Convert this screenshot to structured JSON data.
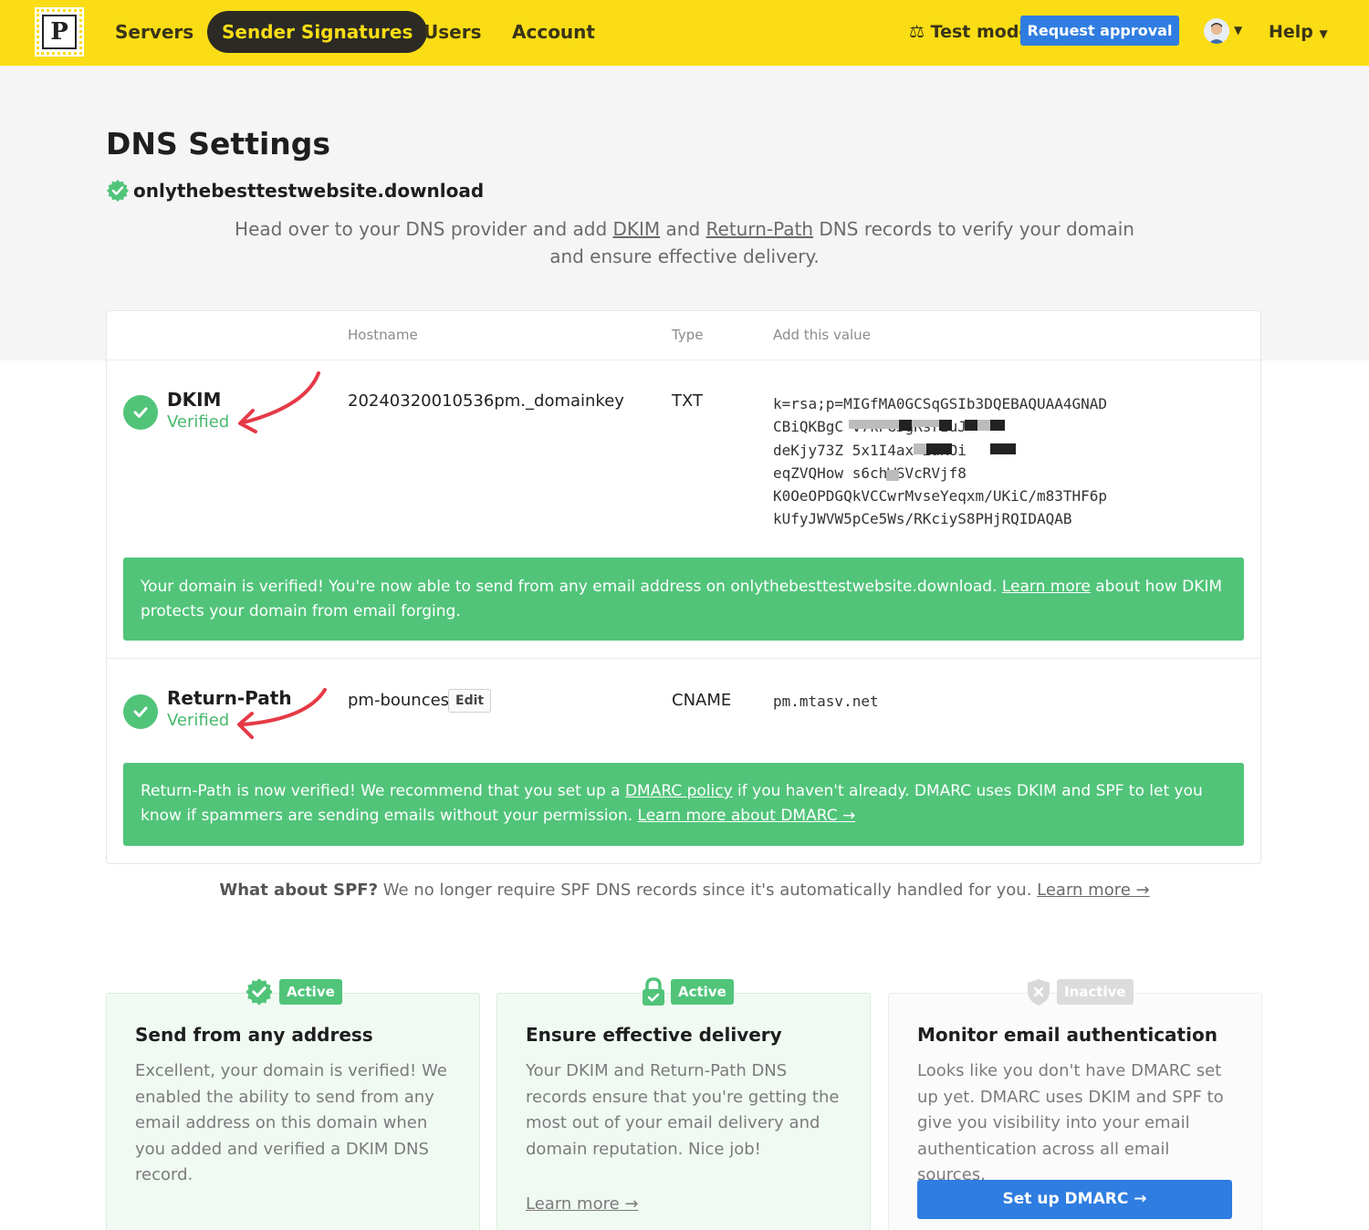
{
  "nav": {
    "logo_letter": "P",
    "items": [
      {
        "label": "Servers"
      },
      {
        "label": "Sender Signatures",
        "active": true
      },
      {
        "label": "Users"
      },
      {
        "label": "Account"
      }
    ],
    "test_mode": "Test mode",
    "request_approval": "Request approval",
    "help": "Help"
  },
  "header": {
    "title": "DNS Settings",
    "domain": "onlythebesttestwebsite.download",
    "intro": {
      "p1": "Head over to your DNS provider and add ",
      "dkim_link": "DKIM",
      "p2": " and ",
      "rp_link": "Return-Path",
      "p3": " DNS records to verify your domain and ensure effective delivery."
    }
  },
  "table": {
    "columns": {
      "hostname": "Hostname",
      "type": "Type",
      "value": "Add this value"
    },
    "dkim": {
      "name": "DKIM",
      "status": "Verified",
      "hostname": "20240320010536pm._domainkey",
      "type": "TXT",
      "value_lines": [
        "k=rsa;p=MIGfMA0GCSqGSIb3DQEBAQUAA4GNAD",
        "CBiQKBgC                   v7kPG3gRsrzuJ",
        "deKjy73Z                   5x1I4ax+2aKOi",
        "eqZVQHow                   s6chWSVcRVjf8",
        "K0OeOPDGQkVCCwrMvseYeqxm/UKiC/m83THF6p",
        "kUfyJWVW5pCe5Ws/RKciyS8PHjRQIDAQAB"
      ],
      "notice": {
        "p1": "Your domain is verified! You're now able to send from any email address on onlythebesttestwebsite.download. ",
        "link": "Learn more",
        "p2": " about how DKIM protects your domain from email forging."
      }
    },
    "return_path": {
      "name": "Return-Path",
      "status": "Verified",
      "hostname": "pm-bounces",
      "edit": "Edit",
      "type": "CNAME",
      "value": "pm.mtasv.net",
      "notice": {
        "p1": "Return-Path is now verified! We recommend that you set up a ",
        "link1": "DMARC policy",
        "p2": " if you haven't already. DMARC uses DKIM and SPF to let you know if spammers are sending emails without your permission. ",
        "link2": "Learn more about DMARC →"
      }
    }
  },
  "spf": {
    "bold": "What about SPF?",
    "text": " We no longer require SPF DNS records since it's automatically handled for you. ",
    "link": "Learn more →"
  },
  "features": [
    {
      "badge": "Active",
      "title": "Send from any address",
      "body": "Excellent, your domain is verified! We enabled the ability to send from any email address on this domain when you added and verified a DKIM DNS record."
    },
    {
      "badge": "Active",
      "title": "Ensure effective delivery",
      "body": "Your DKIM and Return-Path DNS records ensure that you're getting the most out of your email delivery and domain reputation. Nice job!",
      "link": "Learn more →"
    },
    {
      "badge": "Inactive",
      "title": "Monitor email authentication",
      "body": "Looks like you don't have DMARC set up yet. DMARC uses DKIM and SPF to give you visibility into your email authentication across all email sources.",
      "button": "Set up DMARC →"
    }
  ],
  "colors": {
    "nav_yellow": "#fadd14",
    "success_green": "#51c47a",
    "primary_blue": "#2f7de1",
    "annotation_red": "#e63946"
  }
}
